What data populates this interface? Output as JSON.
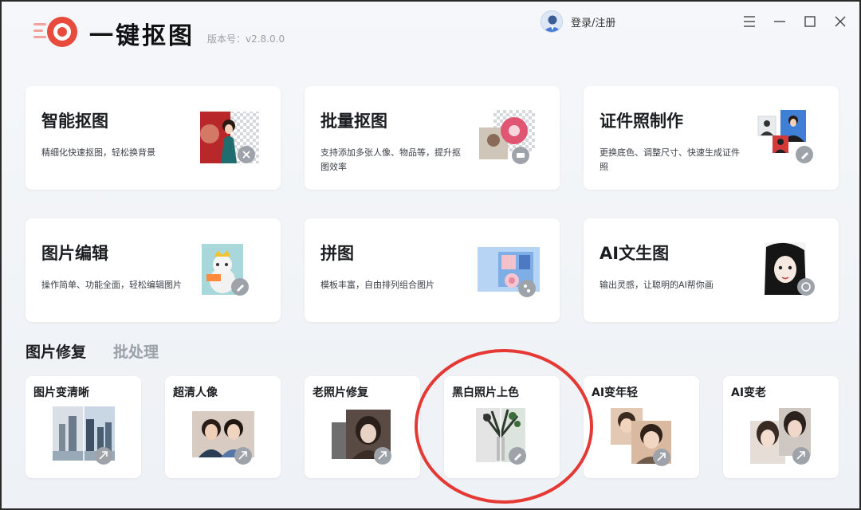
{
  "app": {
    "title": "一键抠图",
    "version": "版本号：v2.8.0.0",
    "login": "登录/注册",
    "accent": "#e84a3c"
  },
  "window_controls": [
    "menu-icon",
    "minimize-icon",
    "maximize-icon",
    "close-icon"
  ],
  "features": [
    {
      "title": "智能抠图",
      "desc": "精细化快速抠图，轻松换背景",
      "icon": "portrait-cutout-icon"
    },
    {
      "title": "批量抠图",
      "desc": "支持添加多张人像、物品等，提升抠图效率",
      "icon": "batch-cutout-icon"
    },
    {
      "title": "证件照制作",
      "desc": "更换底色、调整尺寸、快速生成证件照",
      "icon": "id-photo-icon"
    },
    {
      "title": "图片编辑",
      "desc": "操作简单、功能全面，轻松编辑图片",
      "icon": "image-edit-icon"
    },
    {
      "title": "拼图",
      "desc": "模板丰富，自由排列组合图片",
      "icon": "collage-icon"
    },
    {
      "title": "AI文生图",
      "desc": "输出灵感，让聪明的AI帮你画",
      "icon": "ai-text-to-image-icon"
    }
  ],
  "tabs": [
    {
      "label": "图片修复",
      "active": true
    },
    {
      "label": "批处理",
      "active": false
    }
  ],
  "tools": [
    {
      "title": "图片变清晰",
      "icon": "sharpen-icon"
    },
    {
      "title": "超清人像",
      "icon": "hd-portrait-icon"
    },
    {
      "title": "老照片修复",
      "icon": "old-photo-repair-icon"
    },
    {
      "title": "黑白照片上色",
      "icon": "colorize-icon",
      "highlighted": true
    },
    {
      "title": "AI变年轻",
      "icon": "ai-younger-icon"
    },
    {
      "title": "AI变老",
      "icon": "ai-older-icon"
    }
  ],
  "highlight_color": "#e53935"
}
